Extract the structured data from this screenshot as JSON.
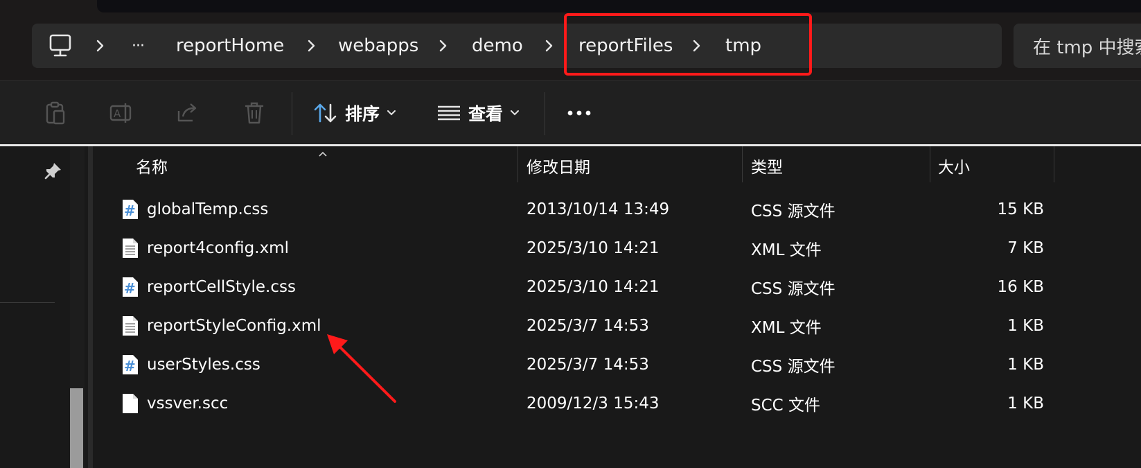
{
  "address_bar": {
    "overflow_label": "···",
    "crumbs": [
      "reportHome",
      "webapps",
      "demo",
      "reportFiles",
      "tmp"
    ]
  },
  "search": {
    "placeholder": "在 tmp 中搜索"
  },
  "toolbar": {
    "sort_label": "排序",
    "view_label": "查看"
  },
  "columns": {
    "name": "名称",
    "modified": "修改日期",
    "type": "类型",
    "size": "大小"
  },
  "files": [
    {
      "name": "globalTemp.css",
      "modified": "2013/10/14 13:49",
      "type": "CSS 源文件",
      "size": "15 KB",
      "icon": "css-file-icon"
    },
    {
      "name": "report4config.xml",
      "modified": "2025/3/10 14:21",
      "type": "XML 文件",
      "size": "7 KB",
      "icon": "xml-file-icon"
    },
    {
      "name": "reportCellStyle.css",
      "modified": "2025/3/10 14:21",
      "type": "CSS 源文件",
      "size": "16 KB",
      "icon": "css-file-icon"
    },
    {
      "name": "reportStyleConfig.xml",
      "modified": "2025/3/7 14:53",
      "type": "XML 文件",
      "size": "1 KB",
      "icon": "xml-file-icon"
    },
    {
      "name": "userStyles.css",
      "modified": "2025/3/7 14:53",
      "type": "CSS 源文件",
      "size": "1 KB",
      "icon": "css-file-icon"
    },
    {
      "name": "vssver.scc",
      "modified": "2009/12/3 15:43",
      "type": "SCC 文件",
      "size": "1 KB",
      "icon": "blank-file-icon"
    }
  ],
  "colors": {
    "annotation_red": "#ff1a1a",
    "css_icon_blue": "#4a8fd6",
    "background": "#191919"
  }
}
